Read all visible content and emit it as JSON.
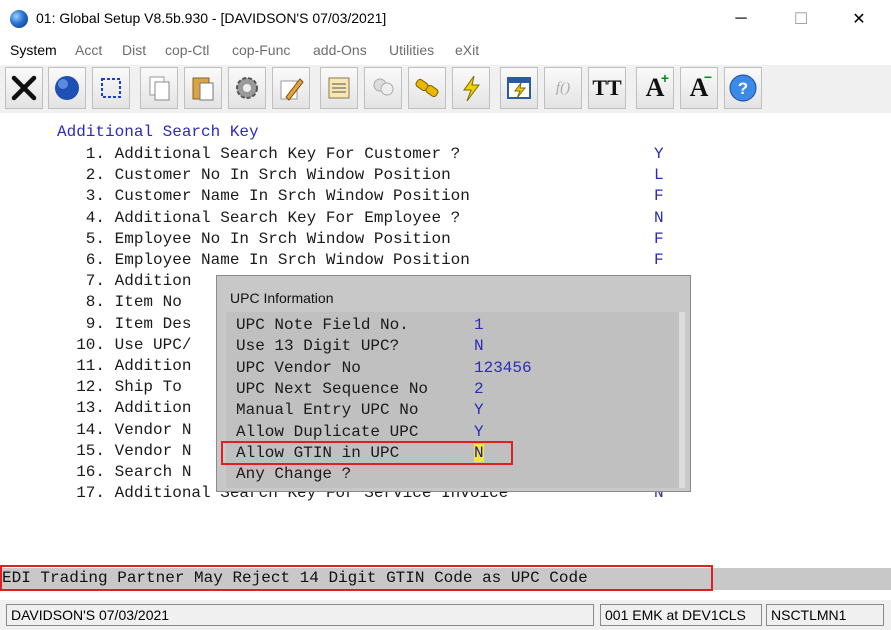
{
  "window": {
    "title": "01: Global Setup V8.5b.930 - [DAVIDSON'S 07/03/2021]",
    "minimize": "─",
    "maximize": "☐",
    "close": "✕"
  },
  "menu": [
    "System",
    "Acct",
    "Dist",
    "cop-Ctl",
    "cop-Func",
    "add-Ons",
    "Utilities",
    "eXit"
  ],
  "toolbar": {
    "buttons": [
      "close-x-icon",
      "globe-icon",
      "select-icon",
      "copy-icon",
      "paste-icon",
      "settings-gear-icon",
      "edit-pencil-icon",
      "notes-icon",
      "group-icon",
      "link-icon",
      "lightning-icon",
      "calculator-icon",
      "function-icon",
      "text-case-icon",
      "font-increase-icon",
      "font-decrease-icon",
      "help-icon"
    ],
    "labels": {
      "tt": "TT",
      "a_plus": "A",
      "a_minus": "A",
      "fx": "f()"
    }
  },
  "screen": {
    "heading": "Additional Search Key",
    "lines": [
      {
        "text": "   1. Additional Search Key For Customer ?",
        "value": "Y"
      },
      {
        "text": "   2. Customer No In Srch Window Position",
        "value": "L"
      },
      {
        "text": "   3. Customer Name In Srch Window Position",
        "value": "F"
      },
      {
        "text": "   4. Additional Search Key For Employee ?",
        "value": "N"
      },
      {
        "text": "   5. Employee No In Srch Window Position",
        "value": "F"
      },
      {
        "text": "   6. Employee Name In Srch Window Position",
        "value": "F"
      },
      {
        "text": "   7. Addition",
        "value": ""
      },
      {
        "text": "   8. Item No",
        "value": ""
      },
      {
        "text": "   9. Item Des",
        "value": ""
      },
      {
        "text": "  10. Use UPC/",
        "value": ""
      },
      {
        "text": "  11. Addition",
        "value": ""
      },
      {
        "text": "  12. Ship To",
        "value": ""
      },
      {
        "text": "  13. Addition",
        "value": ""
      },
      {
        "text": "  14. Vendor N",
        "value": ""
      },
      {
        "text": "  15. Vendor N",
        "value": ""
      },
      {
        "text": "  16. Search N",
        "value": ""
      },
      {
        "text": "  17. Additional Search Key For Service Invoice",
        "value": "N"
      }
    ]
  },
  "popup": {
    "title": "UPC Information",
    "fields": [
      {
        "label": "UPC Note Field No.",
        "value": "1"
      },
      {
        "label": "Use 13 Digit UPC?",
        "value": "N"
      },
      {
        "label": "UPC Vendor No",
        "value": "123456"
      },
      {
        "label": "UPC Next Sequence No",
        "value": "2"
      },
      {
        "label": "Manual Entry UPC No",
        "value": "Y"
      },
      {
        "label": "Allow Duplicate UPC",
        "value": "Y"
      },
      {
        "label": "Allow GTIN in UPC",
        "value": "N"
      },
      {
        "label": "Any Change ?",
        "value": ""
      }
    ]
  },
  "message": "EDI Trading Partner May Reject 14 Digit GTIN Code as UPC Code",
  "status": {
    "company": "DAVIDSON'S 07/03/2021",
    "user": "001 EMK at DEV1CLS",
    "program": "NSCTLMN1"
  },
  "colors": {
    "accent_text": "#2b2bb8",
    "highlight": "#e02020",
    "cursor": "#f5e63c"
  }
}
